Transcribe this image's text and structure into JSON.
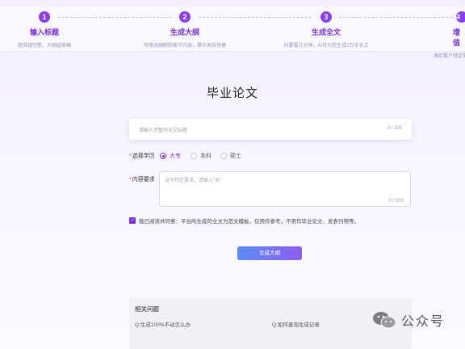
{
  "steps": [
    {
      "num": "1",
      "title": "输入标题",
      "desc": "题目越完整，大纲越准确"
    },
    {
      "num": "2",
      "title": "生成大纲",
      "desc": "可修改细删除章节内容，操作高效快捷"
    },
    {
      "num": "3",
      "title": "生成全文",
      "desc": "问要要几分钟，AI可为您生成2万字长文"
    },
    {
      "num": "4",
      "title": "增值",
      "desc": "满足客户特定需求，提供"
    }
  ],
  "page_title": "毕业论文",
  "title_input": {
    "placeholder": "请输入完整的论文标题",
    "count": "0 / 200"
  },
  "education": {
    "label": "选择学历",
    "options": [
      "大专",
      "本科",
      "硕士"
    ],
    "selected": "大专"
  },
  "content": {
    "label": "内容要求",
    "placeholder": "没有特定要求，请输入\"无\"",
    "count": "0 / 200"
  },
  "agreement": "我已阅读并同意：平台所生成的全文为范文模板，仅用作参考，不用作毕业论文、发表刊物等。",
  "generate_button": "生成大纲",
  "faq": {
    "title": "相关问题",
    "questions": [
      "Q:生成100%不动怎么办",
      "Q:如何查询生成记录"
    ]
  },
  "watermark": "公众号",
  "colors": {
    "accent": "#7a2fe0",
    "button_start": "#5a8cf6",
    "button_end": "#8d5cf3"
  }
}
